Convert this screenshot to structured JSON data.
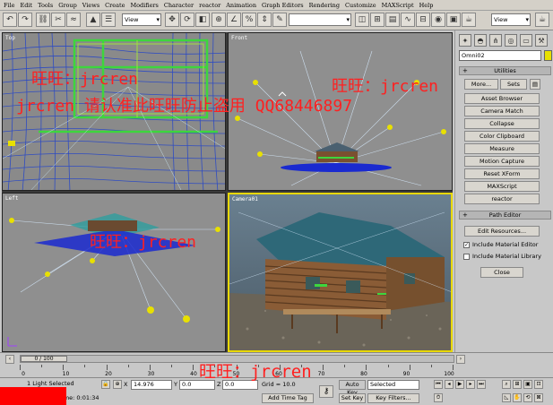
{
  "menu": [
    "File",
    "Edit",
    "Tools",
    "Group",
    "Views",
    "Create",
    "Modifiers",
    "Character",
    "reactor",
    "Animation",
    "Graph Editors",
    "Rendering",
    "Customize",
    "MAXScript",
    "Help"
  ],
  "toolbar": {
    "selection_filter": "View",
    "named_selection": "",
    "coord_system": "View"
  },
  "viewports": {
    "top": "Top",
    "front": "Front",
    "left": "Left",
    "camera": "Camera01"
  },
  "command_panel": {
    "object_name": "Omni02",
    "object_color": "#e8e000",
    "utilities_title": "Utilities",
    "more_label": "More...",
    "sets_label": "Sets",
    "utility_buttons": [
      "Asset Browser",
      "Camera Match",
      "Collapse",
      "Color Clipboard",
      "Measure",
      "Motion Capture",
      "Reset XForm",
      "MAXScript",
      "reactor"
    ],
    "path_editor_title": "Path Editor",
    "edit_resources": "Edit Resources...",
    "include_material_editor": "Include Material Editor",
    "include_material_library": "Include Material Library",
    "close_label": "Close"
  },
  "timeline": {
    "frame_readout": "0 / 100",
    "ticks": [
      "0",
      "10",
      "20",
      "30",
      "40",
      "50",
      "60",
      "70",
      "80",
      "90",
      "100"
    ]
  },
  "status": {
    "selection_info": "1 Light Selected",
    "x_value": "14.976",
    "y_value": "0.0",
    "z_value": "0.0",
    "grid": "Grid = 10.0",
    "render_time": "Rendering Time: 0:01:34",
    "add_time_tag": "Add Time Tag",
    "auto_key": "Auto Key",
    "key_filter_dropdown": "Selected",
    "set_key": "Set Key",
    "key_filters": "Key Filters..."
  },
  "watermarks": {
    "line1_a": "旺旺：jrcren",
    "line1_b": "旺旺：jrcren",
    "line2": "jrcren 请认准此旺旺防止盗用 QQ68446897",
    "line3": "旺旺：jrcren",
    "line4": "旺旺：jrcren"
  }
}
